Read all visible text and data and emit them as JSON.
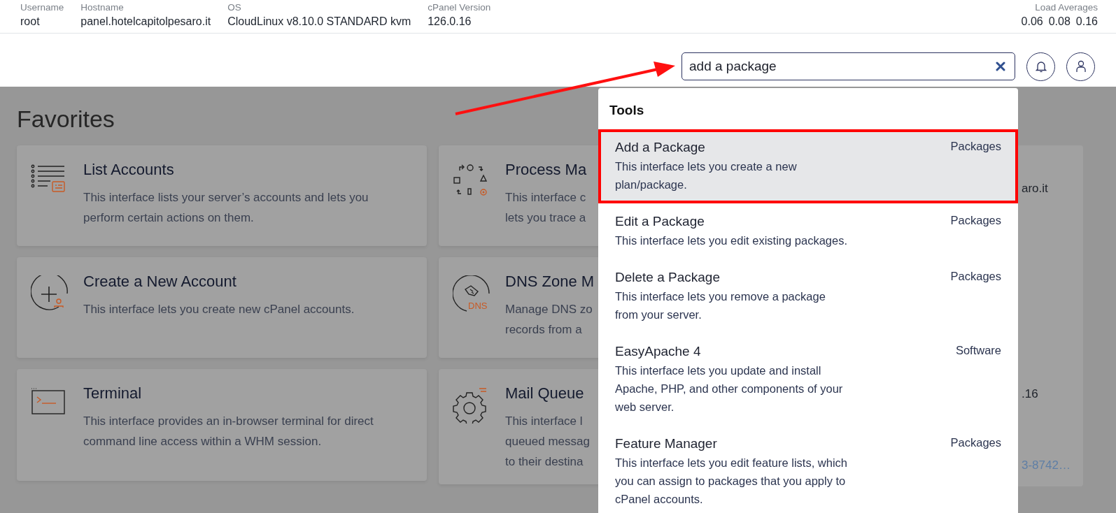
{
  "info_bar": {
    "fields": [
      {
        "label": "Username",
        "value": "root"
      },
      {
        "label": "Hostname",
        "value": "panel.hotelcapitolpesaro.it"
      },
      {
        "label": "OS",
        "value": "CloudLinux v8.10.0 STANDARD kvm"
      },
      {
        "label": "cPanel Version",
        "value": "126.0.16"
      }
    ],
    "load_averages": {
      "label": "Load Averages",
      "values": [
        "0.06",
        "0.08",
        "0.16"
      ]
    }
  },
  "search": {
    "value": "add a package"
  },
  "favorites": {
    "title": "Favorites",
    "cards": [
      {
        "title": "List Accounts",
        "description": "This interface lists your server’s accounts and lets you perform certain actions on them."
      },
      {
        "title": "Process Ma",
        "description_lines": [
          "This interface c",
          "lets you trace a"
        ]
      },
      {
        "title": "Create a New Account",
        "description": "This interface lets you create new cPanel accounts."
      },
      {
        "icon_text": "DNS",
        "title": "DNS Zone M",
        "description_lines": [
          "Manage DNS zo",
          "records from a"
        ]
      },
      {
        "title": "Terminal",
        "description": "This interface provides an in-browser terminal for direct command line access within a WHM session."
      },
      {
        "title": "Mail Queue",
        "description_lines": [
          "This interface l",
          "queued messag",
          "to their destina"
        ]
      }
    ]
  },
  "side_panel": {
    "lines": [
      {
        "kind": "text",
        "text": "aro.it"
      },
      {
        "kind": "text",
        "text": ".16"
      },
      {
        "kind": "link",
        "text": "3-8742…"
      }
    ]
  },
  "dropdown": {
    "heading": "Tools",
    "items": [
      {
        "title": "Add a Package",
        "description": "This interface lets you create a new plan/package.",
        "category": "Packages",
        "selected": true
      },
      {
        "title": "Edit a Package",
        "description": "This interface lets you edit existing packages.",
        "category": "Packages",
        "selected": false
      },
      {
        "title": "Delete a Package",
        "description": "This interface lets you remove a package from your server.",
        "category": "Packages",
        "selected": false
      },
      {
        "title": "EasyApache 4",
        "description": "This interface lets you update and install Apache, PHP, and other components of your web server.",
        "category": "Software",
        "selected": false
      },
      {
        "title": "Feature Manager",
        "description": "This interface lets you edit feature lists, which you can assign to packages that you apply to cPanel accounts.",
        "category": "Packages",
        "selected": false
      }
    ]
  }
}
